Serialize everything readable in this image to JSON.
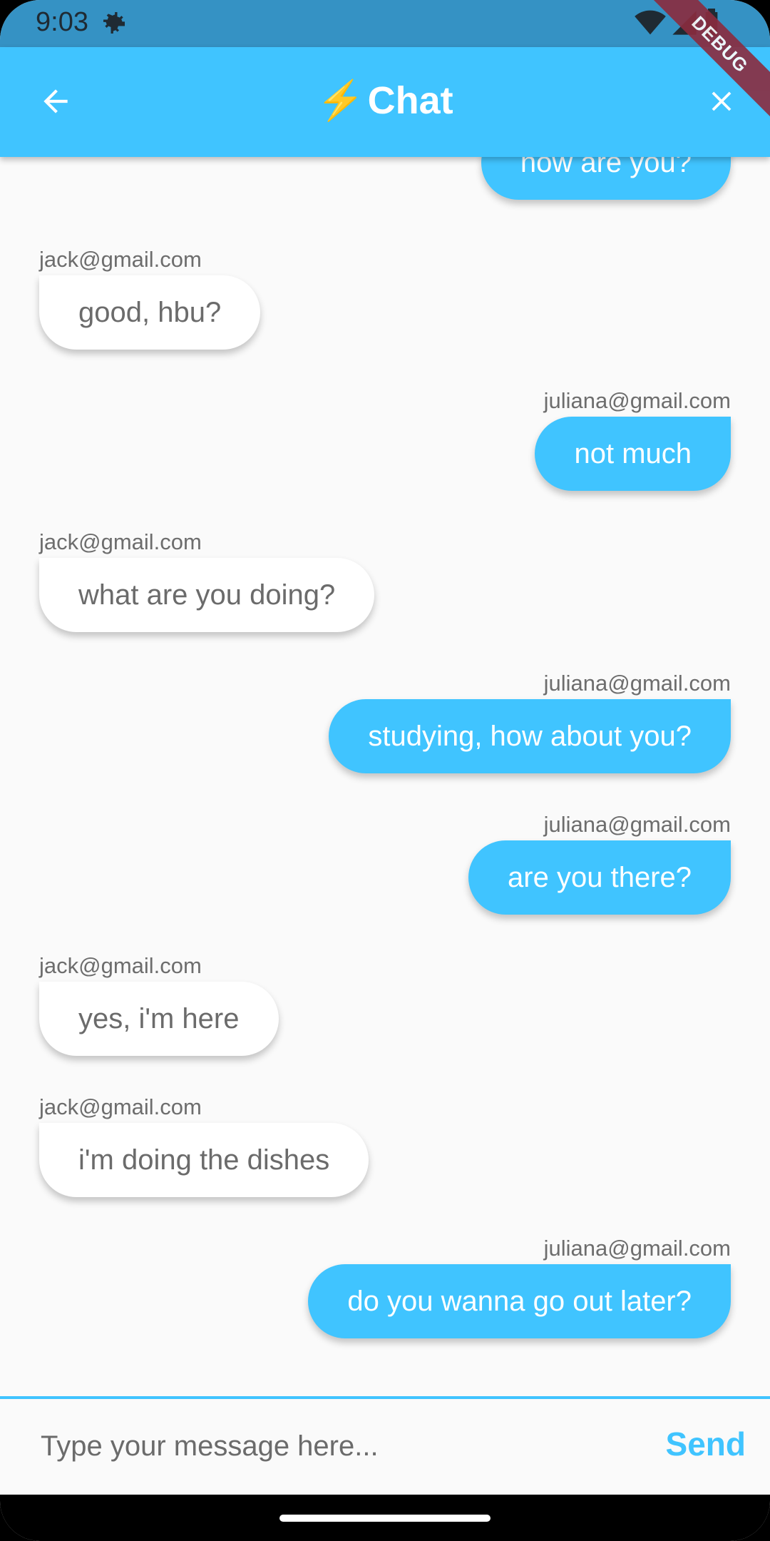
{
  "status_bar": {
    "time": "9:03"
  },
  "app_bar": {
    "title_icon": "⚡",
    "title": "Chat",
    "debug_label": "DEBUG"
  },
  "messages": [
    {
      "side": "right",
      "sender": "",
      "text": "how are you?"
    },
    {
      "side": "left",
      "sender": "jack@gmail.com",
      "text": "good, hbu?"
    },
    {
      "side": "right",
      "sender": "juliana@gmail.com",
      "text": "not much"
    },
    {
      "side": "left",
      "sender": "jack@gmail.com",
      "text": "what are you doing?"
    },
    {
      "side": "right",
      "sender": "juliana@gmail.com",
      "text": "studying, how about you?"
    },
    {
      "side": "right",
      "sender": "juliana@gmail.com",
      "text": "are you there?"
    },
    {
      "side": "left",
      "sender": "jack@gmail.com",
      "text": "yes, i'm here"
    },
    {
      "side": "left",
      "sender": "jack@gmail.com",
      "text": "i'm doing the dishes"
    },
    {
      "side": "right",
      "sender": "juliana@gmail.com",
      "text": "do you wanna go out later?"
    }
  ],
  "composer": {
    "placeholder": "Type your message here...",
    "send_label": "Send"
  },
  "colors": {
    "accent": "#40c4ff",
    "status_bar": "#3592c4",
    "debug_banner": "#8b2c3f"
  }
}
